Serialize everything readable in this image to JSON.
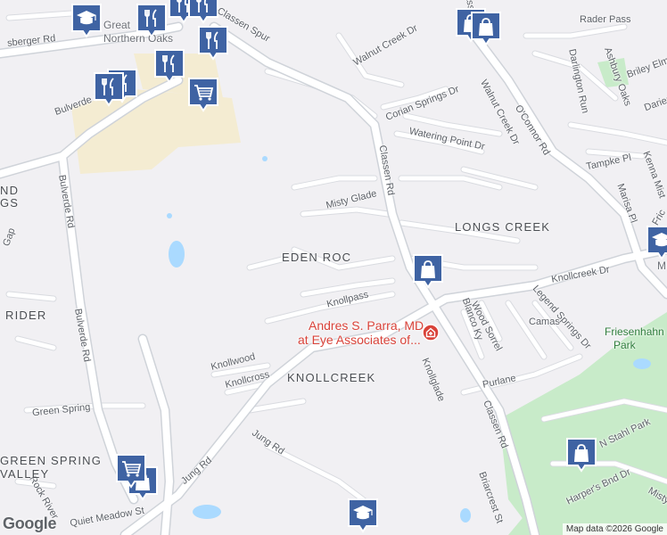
{
  "map": {
    "road_labels": [
      {
        "key": "bulverde_rd_1",
        "text": "Bulverde Rd"
      },
      {
        "key": "bulverde_rd_2",
        "text": "Bulverde Rd"
      },
      {
        "key": "bulverde_rd_3",
        "text": "Bulverde Rd"
      },
      {
        "key": "classen_rd_1",
        "text": "Classen Rd"
      },
      {
        "key": "classen_rd_2",
        "text": "Classen Rd"
      },
      {
        "key": "classen_spur",
        "text": "Classen Spur"
      },
      {
        "key": "classen_rd_top",
        "text": "Classen Rd"
      },
      {
        "key": "oconnor_rd",
        "text": "O'Connor Rd"
      },
      {
        "key": "walnut_creek_dr_1",
        "text": "Walnut Creek Dr"
      },
      {
        "key": "walnut_creek_dr_2",
        "text": "Walnut Creek Dr"
      },
      {
        "key": "corian_springs_dr",
        "text": "Corian Springs Dr"
      },
      {
        "key": "watering_point_dr",
        "text": "Watering Point Dr"
      },
      {
        "key": "rader_pass",
        "text": "Rader Pass"
      },
      {
        "key": "darlington_run",
        "text": "Darlington Run"
      },
      {
        "key": "ashbury_oaks",
        "text": "Ashbury Oaks"
      },
      {
        "key": "briley_elm",
        "text": "Briley Elm"
      },
      {
        "key": "darien",
        "text": "Darien"
      },
      {
        "key": "tampke_pl",
        "text": "Tampke Pl"
      },
      {
        "key": "kenna_mist",
        "text": "Kenna Mist"
      },
      {
        "key": "marisa_pl",
        "text": "Marisa Pl"
      },
      {
        "key": "misty_glade",
        "text": "Misty Glade"
      },
      {
        "key": "knollcreek_dr",
        "text": "Knollcreek Dr"
      },
      {
        "key": "knollpass",
        "text": "Knollpass"
      },
      {
        "key": "blanco_ky",
        "text": "Blanco Ky"
      },
      {
        "key": "wood_sorrel",
        "text": "Wood Sorrel"
      },
      {
        "key": "camas",
        "text": "Camas"
      },
      {
        "key": "legend_springs_dr",
        "text": "Legend Springs Dr"
      },
      {
        "key": "purlane",
        "text": "Purlane"
      },
      {
        "key": "knollglade",
        "text": "Knollglade"
      },
      {
        "key": "knollwood",
        "text": "Knollwood"
      },
      {
        "key": "knollcross",
        "text": "Knollcross"
      },
      {
        "key": "green_spring",
        "text": "Green Spring"
      },
      {
        "key": "jung_rd_1",
        "text": "Jung Rd"
      },
      {
        "key": "jung_rd_2",
        "text": "Jung Rd"
      },
      {
        "key": "quiet_meadow_st",
        "text": "Quiet Meadow St"
      },
      {
        "key": "rock_river",
        "text": "Rock River"
      },
      {
        "key": "briarcrest_st",
        "text": "Briarcrest St"
      },
      {
        "key": "n_stahl_park",
        "text": "N Stahl Park"
      },
      {
        "key": "harpers_bnd_dr",
        "text": "Harper's Bnd Dr"
      },
      {
        "key": "misty",
        "text": "Misty"
      },
      {
        "key": "nberger_rd",
        "text": "sberger Rd"
      },
      {
        "key": "gap",
        "text": "Gap"
      },
      {
        "key": "frio",
        "text": "Fric"
      }
    ],
    "area_labels": [
      {
        "key": "eden_roc",
        "text": "EDEN ROC"
      },
      {
        "key": "longs_creek",
        "text": "LONGS CREEK"
      },
      {
        "key": "knollcreek",
        "text": "KNOLLCREEK"
      },
      {
        "key": "rider",
        "text": "RIDER"
      },
      {
        "key": "green_spring_valley_1",
        "text": "GREEN SPRING"
      },
      {
        "key": "green_spring_valley_2",
        "text": "VALLEY"
      },
      {
        "key": "nd",
        "text": "ND"
      },
      {
        "key": "gs",
        "text": "GS"
      }
    ],
    "poi_labels": {
      "andres_line1": "Andres S. Parra, MD",
      "andres_line2": "at Eye Associates of...",
      "great_northern_oaks_1": "Great",
      "great_northern_oaks_2": "Northern Oaks",
      "friesenhahn_1": "Friesenhahn",
      "friesenhahn_2": "Park",
      "m_label": "M"
    },
    "markers": [
      {
        "key": "school_top",
        "icon": "school-icon"
      },
      {
        "key": "restaurant_top_1",
        "icon": "restaurant-icon"
      },
      {
        "key": "restaurant_top_2",
        "icon": "restaurant-icon"
      },
      {
        "key": "restaurant_top_3",
        "icon": "restaurant-icon"
      },
      {
        "key": "restaurant_mid_1",
        "icon": "restaurant-icon"
      },
      {
        "key": "restaurant_mid_2",
        "icon": "restaurant-icon"
      },
      {
        "key": "restaurant_left_1",
        "icon": "restaurant-icon"
      },
      {
        "key": "restaurant_left_2",
        "icon": "restaurant-icon"
      },
      {
        "key": "shopping_cart_1",
        "icon": "shopping-cart-icon"
      },
      {
        "key": "shopping_bag_topright_1",
        "icon": "shopping-bag-icon"
      },
      {
        "key": "shopping_bag_topright_2",
        "icon": "shopping-bag-icon"
      },
      {
        "key": "shopping_bag_center",
        "icon": "shopping-bag-icon"
      },
      {
        "key": "shopping_bag_right",
        "icon": "shopping-bag-icon"
      },
      {
        "key": "shopping_bag_bottomleft",
        "icon": "shopping-bag-icon"
      },
      {
        "key": "shopping_cart_bottomleft",
        "icon": "shopping-cart-icon"
      },
      {
        "key": "school_bottom",
        "icon": "school-icon"
      },
      {
        "key": "school_right",
        "icon": "school-icon"
      },
      {
        "key": "hospital",
        "icon": "hospital-icon"
      }
    ],
    "attribution": "Map data ©2026 Google",
    "logo": "Google",
    "colors": {
      "background": "#f1f0f3",
      "road": "#ffffff",
      "road_edge": "#d9dbe0",
      "major_road": "#ffffff",
      "commercial": "#f4ecd2",
      "park": "#c8ebc9",
      "water": "#aadaff",
      "marker_fill": "#3f63a3",
      "marker_border": "#ffffff",
      "poi_red": "#d9433a"
    }
  }
}
